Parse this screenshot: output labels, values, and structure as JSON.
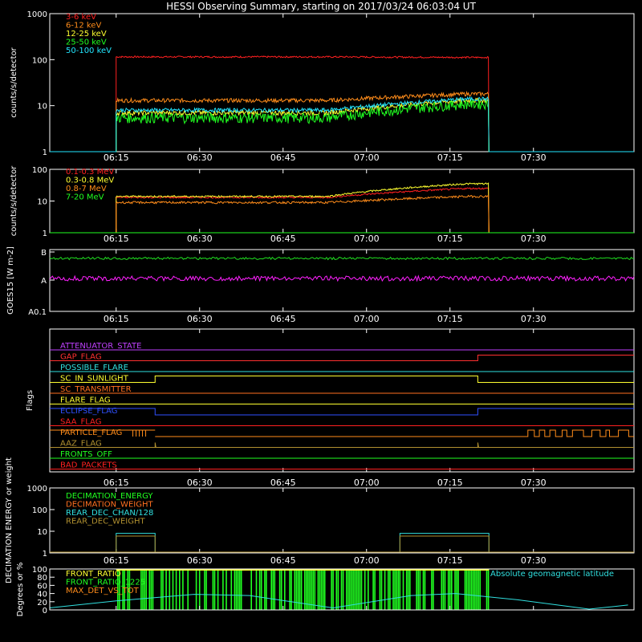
{
  "title": "HESSI Observing Summary, starting on 2017/03/24 06:03:04 UT",
  "time_ticks": [
    "06:15",
    "06:30",
    "06:45",
    "07:00",
    "07:15",
    "07:30"
  ],
  "chart_data": [
    {
      "type": "line",
      "name": "panel-lowE",
      "ylabel": "counts/s/detector",
      "ylog": true,
      "ylim": [
        1,
        1000
      ],
      "yticks": [
        {
          "v": 1,
          "label": "1"
        },
        {
          "v": 10,
          "label": "10"
        },
        {
          "v": 100,
          "label": "100"
        },
        {
          "v": 1000,
          "label": "1000"
        }
      ],
      "obs_window": [
        "06:15",
        "07:22"
      ],
      "series": [
        {
          "name": "3-6 keV",
          "color": "#ff2020",
          "level": [
            115,
            112
          ],
          "noise": 0.04
        },
        {
          "name": "6-12 keV",
          "color": "#ff8c1a",
          "level": [
            13,
            18
          ],
          "noise": 0.1
        },
        {
          "name": "12-25 keV",
          "color": "#ffff30",
          "level": [
            7,
            13
          ],
          "noise": 0.12
        },
        {
          "name": "25-50 keV",
          "color": "#20ff20",
          "level": [
            5.5,
            11
          ],
          "noise": 0.25
        },
        {
          "name": "50-100 keV",
          "color": "#22e6ff",
          "level": [
            8,
            14
          ],
          "noise": 0.1
        }
      ]
    },
    {
      "type": "line",
      "name": "panel-highE",
      "ylabel": "counts/s/detector",
      "ylog": true,
      "ylim": [
        1,
        100
      ],
      "yticks": [
        {
          "v": 1,
          "label": "1"
        },
        {
          "v": 10,
          "label": "10"
        },
        {
          "v": 100,
          "label": "100"
        }
      ],
      "obs_window": [
        "06:15",
        "07:22"
      ],
      "series": [
        {
          "name": "0.1-0.3 MeV",
          "color": "#ff2020",
          "level": [
            13,
            25
          ],
          "noise": 0.06
        },
        {
          "name": "0.3-0.8 MeV",
          "color": "#ffff30",
          "level": [
            14,
            35
          ],
          "noise": 0.06
        },
        {
          "name": "0.8-7 MeV",
          "color": "#ff8c1a",
          "level": [
            9,
            14
          ],
          "noise": 0.08
        },
        {
          "name": "7-20 MeV",
          "color": "#20ff20",
          "level": [
            1,
            1
          ],
          "noise": 0.0
        }
      ]
    },
    {
      "type": "line",
      "name": "panel-goes",
      "ylabel": "GOES15 [W m-2]",
      "yticks": [
        {
          "label": "A0.1"
        },
        {
          "label": "A"
        },
        {
          "label": "B"
        }
      ],
      "series": [
        {
          "name": "GOES long",
          "color": "#20e020",
          "level": "B-"
        },
        {
          "name": "GOES short",
          "color": "#ff20ff",
          "level": "A"
        }
      ]
    },
    {
      "type": "line",
      "name": "panel-flags",
      "ylabel": "Flags",
      "series": [
        {
          "name": "ATTENUATOR_STATE",
          "color": "#c040ff"
        },
        {
          "name": "GAP_FLAG",
          "color": "#ff3030"
        },
        {
          "name": "POSSIBLE_FLARE",
          "color": "#30e0e0"
        },
        {
          "name": "SC_IN_SUNLIGHT",
          "color": "#ffff30"
        },
        {
          "name": "SC_TRANSMITTER",
          "color": "#ff7020"
        },
        {
          "name": "FLARE_FLAG",
          "color": "#ffff30"
        },
        {
          "name": "ECLIPSE_FLAG",
          "color": "#3050ff"
        },
        {
          "name": "SAA_FLAG",
          "color": "#ff2020"
        },
        {
          "name": "PARTICLE_FLAG",
          "color": "#ff8c1a"
        },
        {
          "name": "AAZ_FLAG",
          "color": "#b09030"
        },
        {
          "name": "FRONTS_OFF",
          "color": "#20ff20"
        },
        {
          "name": "BAD_PACKETS",
          "color": "#ff2020"
        }
      ]
    },
    {
      "type": "line",
      "name": "panel-decimation",
      "ylabel": "DECIMATION ENERGY or weight",
      "ylog": true,
      "ylim": [
        1,
        1000
      ],
      "yticks": [
        {
          "v": 1,
          "label": "1"
        },
        {
          "v": 10,
          "label": "10"
        },
        {
          "v": 100,
          "label": "100"
        },
        {
          "v": 1000,
          "label": "1000"
        }
      ],
      "series": [
        {
          "name": "DECIMATION_ENERGY",
          "color": "#20ff20"
        },
        {
          "name": "DECIMATION_WEIGHT",
          "color": "#ff7020"
        },
        {
          "name": "REAR_DEC_CHAN/128",
          "color": "#30e0e0",
          "segments": [
            [
              "06:15",
              "06:22",
              8
            ],
            [
              "07:06",
              "07:22",
              8
            ]
          ]
        },
        {
          "name": "REAR_DEC_WEIGHT",
          "color": "#b09030",
          "segments": [
            [
              "06:15",
              "06:22",
              6
            ],
            [
              "07:06",
              "07:22",
              6
            ]
          ]
        }
      ]
    },
    {
      "type": "line",
      "name": "panel-ratio",
      "ylabel": "Degrees or %",
      "ylim": [
        0,
        100
      ],
      "yticks": [
        {
          "v": 0,
          "label": "0"
        },
        {
          "v": 20,
          "label": "20"
        },
        {
          "v": 40,
          "label": "40"
        },
        {
          "v": 60,
          "label": "60"
        },
        {
          "v": 80,
          "label": "80"
        },
        {
          "v": 100,
          "label": "100"
        }
      ],
      "series": [
        {
          "name": "FRONT_RATIO",
          "color": "#ffff30"
        },
        {
          "name": "FRONT_RATIO_1225",
          "color": "#20ff20"
        },
        {
          "name": "MAX_DET_VS_TOT",
          "color": "#ff8c1a"
        },
        {
          "name": "Absolute geomagnetic latitude",
          "color": "#30e0e0",
          "points": [
            [
              "06:03",
              5
            ],
            [
              "06:15",
              22
            ],
            [
              "06:29",
              38
            ],
            [
              "06:39",
              35
            ],
            [
              "06:54",
              5
            ],
            [
              "07:08",
              35
            ],
            [
              "07:16",
              40
            ],
            [
              "07:27",
              25
            ],
            [
              "07:40",
              2
            ],
            [
              "07:47",
              12
            ]
          ]
        }
      ]
    }
  ]
}
